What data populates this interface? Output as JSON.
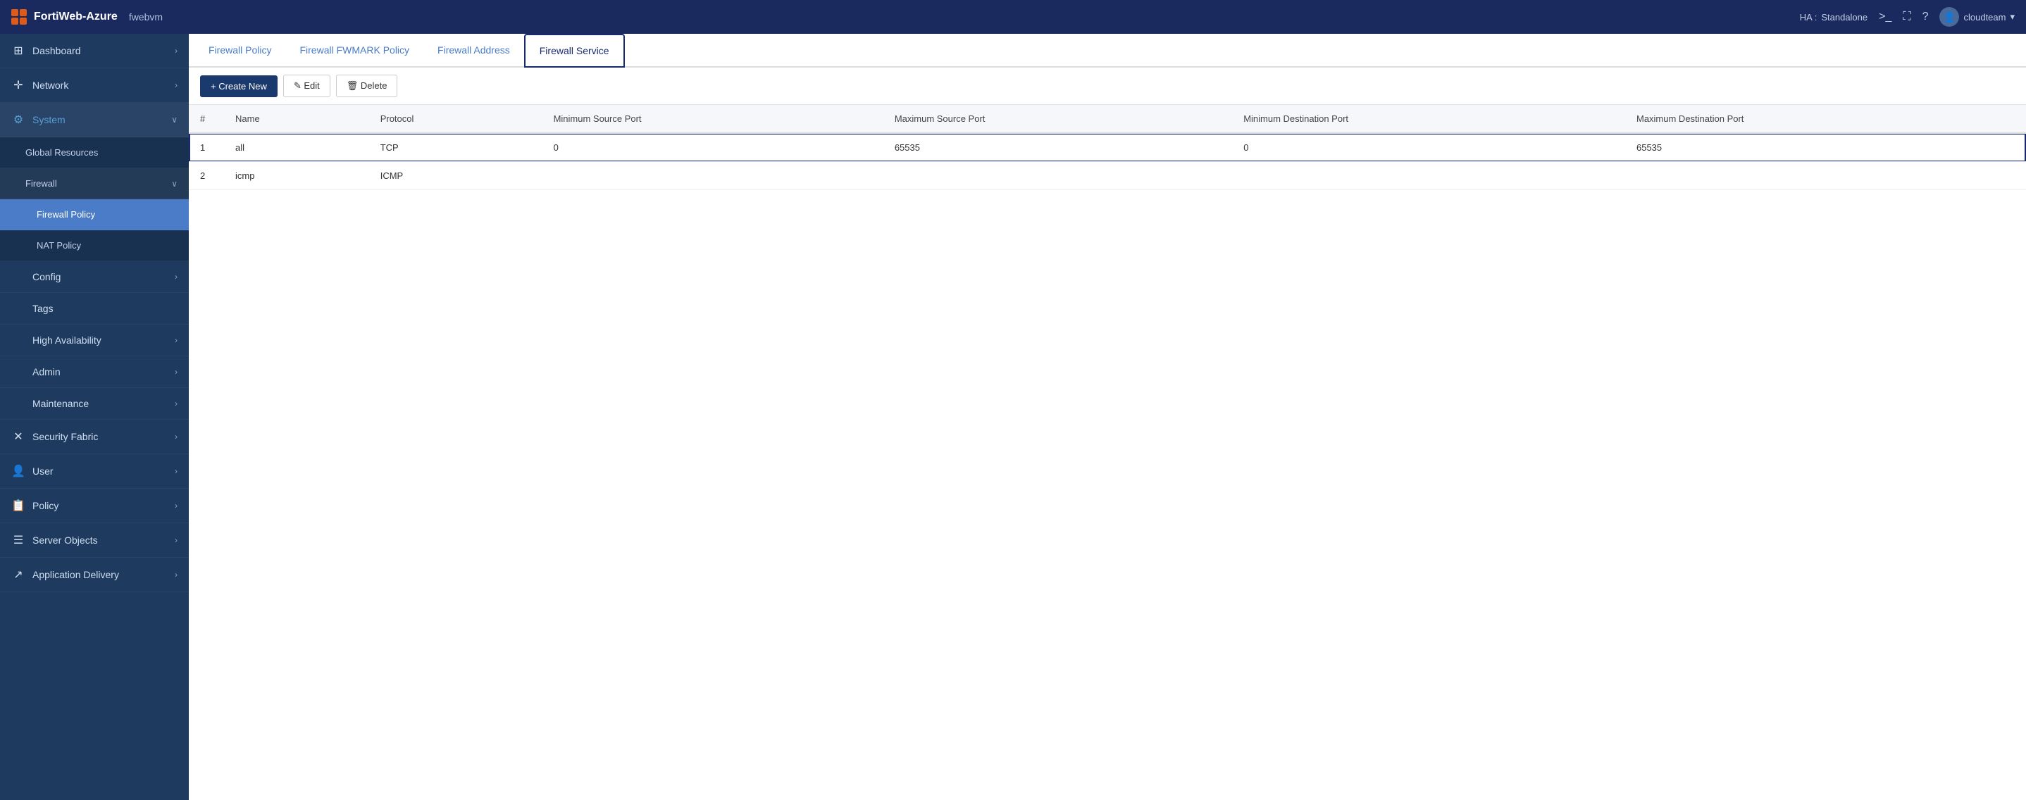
{
  "header": {
    "logo_text": "FortiWeb-Azure",
    "hostname": "fwebvm",
    "ha_label": "HA :",
    "ha_status": "Standalone",
    "terminal_icon": ">_",
    "fullscreen_icon": "⛶",
    "help_icon": "?",
    "username": "cloudteam",
    "dropdown_icon": "▾"
  },
  "sidebar": {
    "items": [
      {
        "id": "dashboard",
        "label": "Dashboard",
        "icon": "⊞",
        "has_arrow": true,
        "active": false
      },
      {
        "id": "network",
        "label": "Network",
        "icon": "✛",
        "has_arrow": true,
        "active": false
      },
      {
        "id": "system",
        "label": "System",
        "icon": "⚙",
        "has_arrow": false,
        "active": true,
        "expanded": true
      },
      {
        "id": "global-resources",
        "label": "Global Resources",
        "icon": "",
        "has_arrow": false,
        "active": false,
        "sub": true
      },
      {
        "id": "firewall",
        "label": "Firewall",
        "icon": "",
        "has_arrow": false,
        "active": true,
        "expanded": true,
        "sub": true
      },
      {
        "id": "firewall-policy",
        "label": "Firewall Policy",
        "icon": "",
        "has_arrow": false,
        "active": true,
        "sub": true,
        "subsub": true
      },
      {
        "id": "nat-policy",
        "label": "NAT Policy",
        "icon": "",
        "has_arrow": false,
        "active": false,
        "sub": true,
        "subsub": true
      },
      {
        "id": "config",
        "label": "Config",
        "icon": "",
        "has_arrow": true,
        "active": false
      },
      {
        "id": "tags",
        "label": "Tags",
        "icon": "",
        "has_arrow": false,
        "active": false
      },
      {
        "id": "high-availability",
        "label": "High Availability",
        "icon": "",
        "has_arrow": true,
        "active": false
      },
      {
        "id": "admin",
        "label": "Admin",
        "icon": "",
        "has_arrow": true,
        "active": false
      },
      {
        "id": "maintenance",
        "label": "Maintenance",
        "icon": "",
        "has_arrow": true,
        "active": false
      },
      {
        "id": "security-fabric",
        "label": "Security Fabric",
        "icon": "✕",
        "has_arrow": true,
        "active": false
      },
      {
        "id": "user",
        "label": "User",
        "icon": "👤",
        "has_arrow": true,
        "active": false
      },
      {
        "id": "policy",
        "label": "Policy",
        "icon": "📋",
        "has_arrow": true,
        "active": false
      },
      {
        "id": "server-objects",
        "label": "Server Objects",
        "icon": "☰",
        "has_arrow": true,
        "active": false
      },
      {
        "id": "application-delivery",
        "label": "Application Delivery",
        "icon": "↗",
        "has_arrow": true,
        "active": false
      }
    ]
  },
  "tabs": [
    {
      "id": "firewall-policy",
      "label": "Firewall Policy",
      "active": false
    },
    {
      "id": "firewall-fwmark",
      "label": "Firewall FWMARK Policy",
      "active": false
    },
    {
      "id": "firewall-address",
      "label": "Firewall Address",
      "active": false
    },
    {
      "id": "firewall-service",
      "label": "Firewall Service",
      "active": true
    }
  ],
  "toolbar": {
    "create_new_label": "+ Create New",
    "edit_label": "✎ Edit",
    "delete_label": "🗑 Delete"
  },
  "table": {
    "columns": [
      "#",
      "Name",
      "Protocol",
      "Minimum Source Port",
      "Maximum Source Port",
      "Minimum Destination Port",
      "Maximum Destination Port"
    ],
    "rows": [
      {
        "num": "1",
        "name": "all",
        "protocol": "TCP",
        "min_src": "0",
        "max_src": "65535",
        "min_dst": "0",
        "max_dst": "65535",
        "selected": true
      },
      {
        "num": "2",
        "name": "icmp",
        "protocol": "ICMP",
        "min_src": "",
        "max_src": "",
        "min_dst": "",
        "max_dst": "",
        "selected": false
      }
    ]
  }
}
